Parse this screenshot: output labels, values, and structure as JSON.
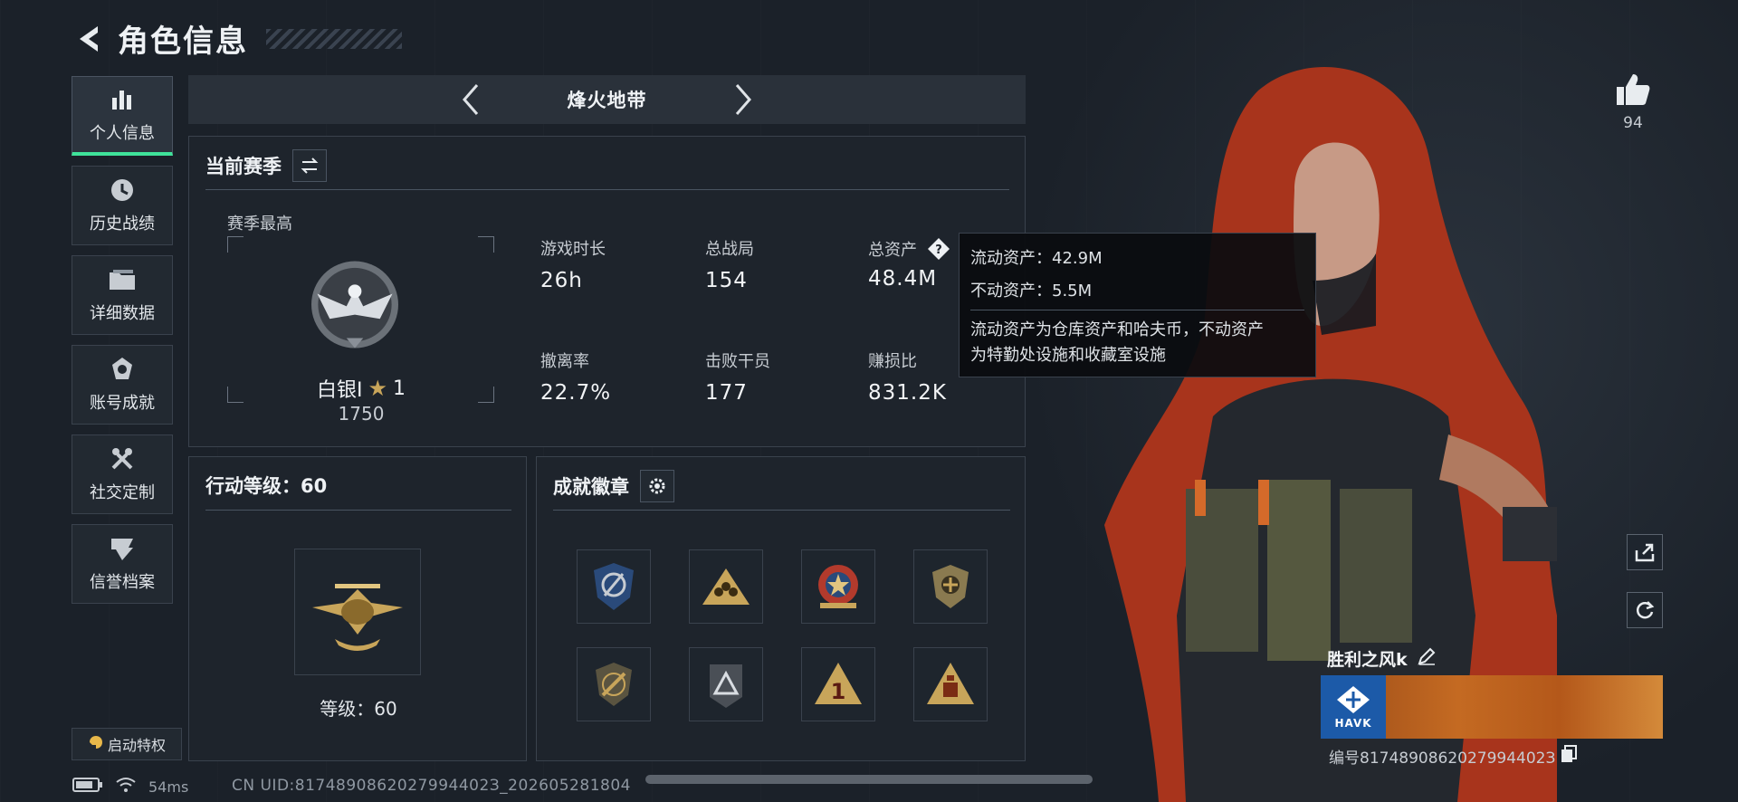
{
  "header": {
    "title": "角色信息"
  },
  "sidebar": {
    "items": [
      {
        "label": "个人信息",
        "icon": "bar-chart-icon",
        "active": true
      },
      {
        "label": "历史战绩",
        "icon": "history-clock-icon",
        "active": false
      },
      {
        "label": "详细数据",
        "icon": "folder-icon",
        "active": false
      },
      {
        "label": "账号成就",
        "icon": "medal-icon",
        "active": false
      },
      {
        "label": "社交定制",
        "icon": "tools-icon",
        "active": false
      },
      {
        "label": "信誉档案",
        "icon": "reputation-icon",
        "active": false
      }
    ],
    "privilege_label": "启动特权"
  },
  "mode": {
    "title": "烽火地带"
  },
  "season": {
    "title": "当前赛季",
    "best_label": "赛季最高",
    "rank_name": "白银I",
    "rank_stars": "1",
    "rank_score": "1750",
    "stats": {
      "play_time": {
        "label": "游戏时长",
        "value": "26h"
      },
      "total_matches": {
        "label": "总战局",
        "value": "154"
      },
      "total_assets": {
        "label": "总资产",
        "value": "48.4M"
      },
      "extract_rate": {
        "label": "撤离率",
        "value": "22.7%"
      },
      "defeated_operators": {
        "label": "击败干员",
        "value": "177"
      },
      "profit_ratio": {
        "label": "赚损比",
        "value": "831.2K"
      }
    }
  },
  "tooltip": {
    "liquid": "流动资产：42.9M",
    "fixed": "不动资产：5.5M",
    "desc_line1": "流动资产为仓库资产和哈夫币，不动资产",
    "desc_line2": "为特勤处设施和收藏室设施"
  },
  "action_level": {
    "title": "行动等级：60",
    "level_text": "等级：60"
  },
  "achievements": {
    "title": "成就徽章",
    "badges": [
      "shield-emblem-icon",
      "triangle-squad-icon",
      "star-badge-icon",
      "gold-shield-icon",
      "sword-shield-icon",
      "pyramid-badge-icon",
      "number-one-triangle-icon",
      "warning-triangle-icon"
    ]
  },
  "status": {
    "ping": "54ms",
    "uid": "CN UID:8174890862027994402З_202605281804"
  },
  "profile": {
    "like_count": "94",
    "player_name": "胜利之风k",
    "card_brand": "HAVK",
    "player_id": "编号8174890862027994402З"
  },
  "colors": {
    "accent_green": "#3fe39a",
    "background": "#1b2129",
    "panel": "#1e252d",
    "gold": "#c8a55a"
  }
}
